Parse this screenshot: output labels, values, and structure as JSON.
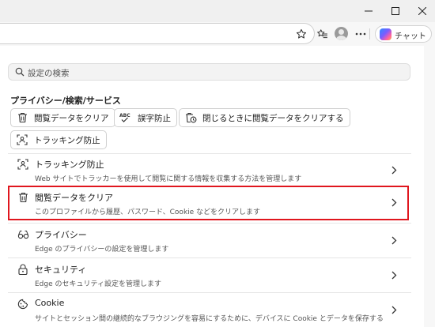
{
  "window": {
    "minimize_glyph": "—",
    "icons": [
      "minimize-icon",
      "maximize-icon",
      "close-icon"
    ]
  },
  "toolbar": {
    "icons": [
      "star-icon",
      "favorites-icon",
      "profile-avatar",
      "more-icon",
      "copilot-icon"
    ],
    "copilot_label": "チャット"
  },
  "search": {
    "placeholder": "設定の検索"
  },
  "section": {
    "title": "プライバシー/検索/サービス",
    "chips": [
      {
        "label": "閲覧データをクリア",
        "icon": "trash-icon"
      },
      {
        "label": "誤字防止",
        "icon": "spellcheck-icon"
      },
      {
        "label": "閉じるときに閲覧データをクリアする",
        "icon": "trash-clock-icon"
      },
      {
        "label": "トラッキング防止",
        "icon": "tracking-icon"
      }
    ]
  },
  "rows": [
    {
      "title": "トラッキング防止",
      "desc": "Web サイトでトラッカーを使用して閲覧に関する情報を収集する方法を管理します",
      "icon": "tracking-icon"
    },
    {
      "title": "閲覧データをクリア",
      "desc": "このプロファイルから履歴、パスワード、Cookie などをクリアします",
      "icon": "trash-icon",
      "highlighted": true
    },
    {
      "title": "プライバシー",
      "desc": "Edge のプライバシーの設定を管理します",
      "icon": "glasses-icon"
    },
    {
      "title": "セキュリティ",
      "desc": "Edge のセキュリティ設定を管理します",
      "icon": "lock-icon"
    },
    {
      "title": "Cookie",
      "desc": "サイトとセッション間の継続的なブラウジングを容易にするために、デバイスに Cookie とデータを保存する",
      "icon": "cookie-icon"
    }
  ],
  "colors": {
    "highlight_border": "#e0161e",
    "content_bg": "#ffffff",
    "chrome_bg": "#f7f7f7"
  }
}
